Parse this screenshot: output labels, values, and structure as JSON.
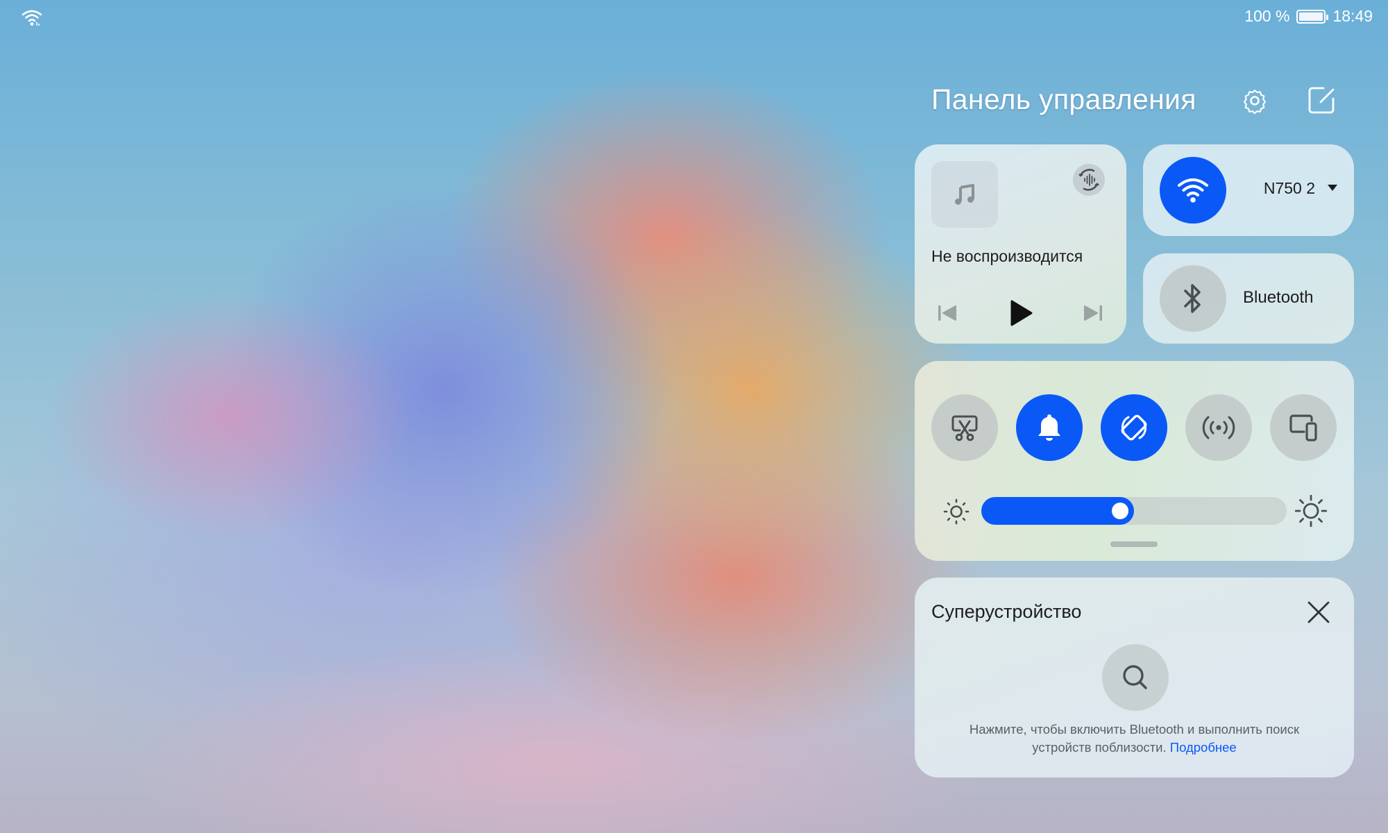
{
  "status_bar": {
    "wifi_icon": "wifi-icon",
    "battery_percent": "100 %",
    "battery_icon": "battery-icon",
    "battery_level": 1.0,
    "time": "18:49"
  },
  "panel": {
    "title": "Панель управления",
    "settings_icon": "gear-icon",
    "edit_icon": "edit-icon"
  },
  "media": {
    "album_icon": "music-note-icon",
    "audio_switch_icon": "audio-output-icon",
    "status": "Не воспроизводится",
    "controls": [
      "previous-icon",
      "play-icon",
      "next-icon"
    ]
  },
  "wifi": {
    "enabled": true,
    "network_name": "N750 2",
    "icon": "wifi-icon"
  },
  "bluetooth": {
    "enabled": false,
    "label": "Bluetooth",
    "icon": "bluetooth-icon"
  },
  "toggles": [
    {
      "name": "screenshot",
      "icon": "scissors-screenshot-icon",
      "on": false
    },
    {
      "name": "sound",
      "icon": "bell-icon",
      "on": true
    },
    {
      "name": "auto-rotate",
      "icon": "rotate-icon",
      "on": true
    },
    {
      "name": "hotspot",
      "icon": "hotspot-icon",
      "on": false
    },
    {
      "name": "multi-screen",
      "icon": "multi-device-icon",
      "on": false
    }
  ],
  "brightness": {
    "level": 0.5,
    "low_icon": "sun-small-icon",
    "high_icon": "sun-large-icon"
  },
  "superdevice": {
    "title": "Суперустройство",
    "close_icon": "close-icon",
    "search_icon": "search-icon",
    "hint": "Нажмите, чтобы включить Bluetooth и выполнить поиск устройств поблизости.",
    "link": "Подробнее"
  },
  "colors": {
    "accent": "#0a59f7",
    "text": "#1c1c1c",
    "hint_text": "#5a5f62"
  }
}
